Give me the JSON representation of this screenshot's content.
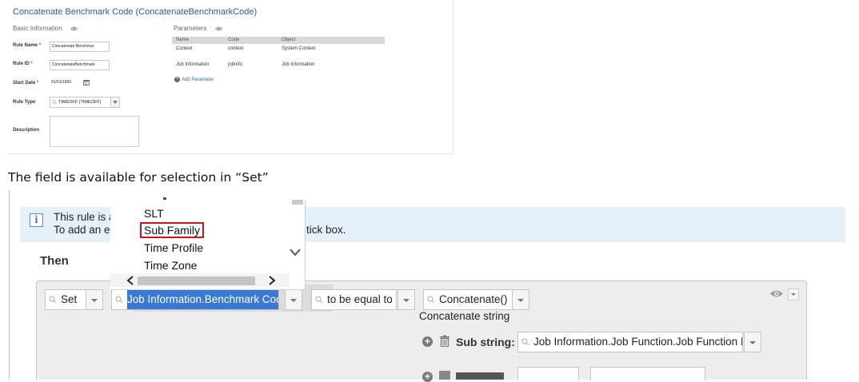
{
  "rule_editor": {
    "title": "Concatenate Benchmark Code (ConcatenateBenchmarkCode)",
    "basic_info_header": "Basic Information",
    "parameters_header": "Parameters",
    "fields": {
      "rule_name_label": "Rule Name",
      "rule_name_value": "Concatenate Benchmar",
      "rule_id_label": "Rule ID",
      "rule_id_value": "ConcatenateBenchmark",
      "start_date_label": "Start Date",
      "start_date_value": "01/01/1900",
      "rule_type_label": "Rule Type",
      "rule_type_value": "TIMEOFF (TIMEOFF)",
      "description_label": "Description",
      "required_mark": "*"
    },
    "parameters": {
      "columns": [
        "Name",
        "Code",
        "Object"
      ],
      "rows": [
        [
          "Context",
          "context",
          "System Context"
        ],
        [
          "Job Information",
          "jobInfo",
          "Job Information"
        ]
      ],
      "add_label": "Add Parameter"
    }
  },
  "caption": "The field is available for selection in “Set”",
  "info_banner": {
    "line1": "This rule is a",
    "line1_tail": "tick box.",
    "line2": "To add an e"
  },
  "then_label": "Then",
  "dropdown": {
    "items": [
      "SLT",
      "Sub Family",
      "Time Profile",
      "Time Zone"
    ],
    "highlighted": "Sub Family"
  },
  "row": {
    "action": "Set",
    "field": "Job Information.Benchmark Code",
    "operator": "to be equal to",
    "function": "Concatenate()",
    "concat_label": "Concatenate string",
    "sub_string_label": "Sub string:",
    "sub_string_value": "Job Information.Job Function.Job Function ID"
  },
  "colors": {
    "title_blue": "#2b5d8c",
    "info_bg": "#e5f1fa",
    "selection_blue": "#3a78d6",
    "highlight_red": "#d0141c"
  }
}
